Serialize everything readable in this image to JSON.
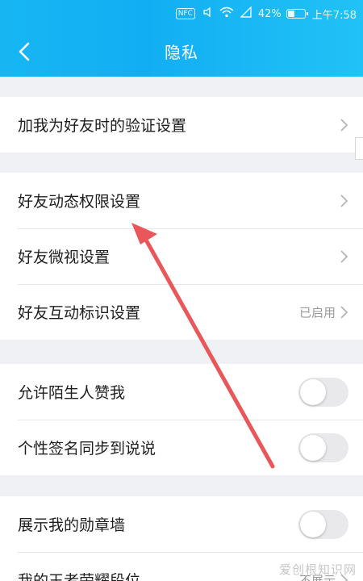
{
  "status_bar": {
    "nfc": "NFC",
    "battery": "42%",
    "battery_level": 0.42,
    "time": "上午7:58"
  },
  "header": {
    "title": "隐私"
  },
  "groups": [
    {
      "rows": [
        {
          "label": "加我为好友时的验证设置",
          "control": "chevron"
        }
      ]
    },
    {
      "rows": [
        {
          "label": "好友动态权限设置",
          "control": "chevron"
        },
        {
          "label": "好友微视设置",
          "control": "chevron"
        },
        {
          "label": "好友互动标识设置",
          "value": "已启用",
          "control": "chevron"
        }
      ]
    },
    {
      "rows": [
        {
          "label": "允许陌生人赞我",
          "control": "toggle",
          "on": false
        },
        {
          "label": "个性签名同步到说说",
          "control": "toggle",
          "on": false
        }
      ]
    },
    {
      "rows": [
        {
          "label": "展示我的勋章墙",
          "control": "toggle",
          "on": false
        },
        {
          "label": "我的王者荣耀段位",
          "value": "不展示",
          "control": "chevron"
        }
      ]
    }
  ],
  "watermark": "爱创根知识网",
  "colors": {
    "header_start": "#17b6f3",
    "header_end": "#21c2f6",
    "annotation_arrow": "#e9575a"
  }
}
